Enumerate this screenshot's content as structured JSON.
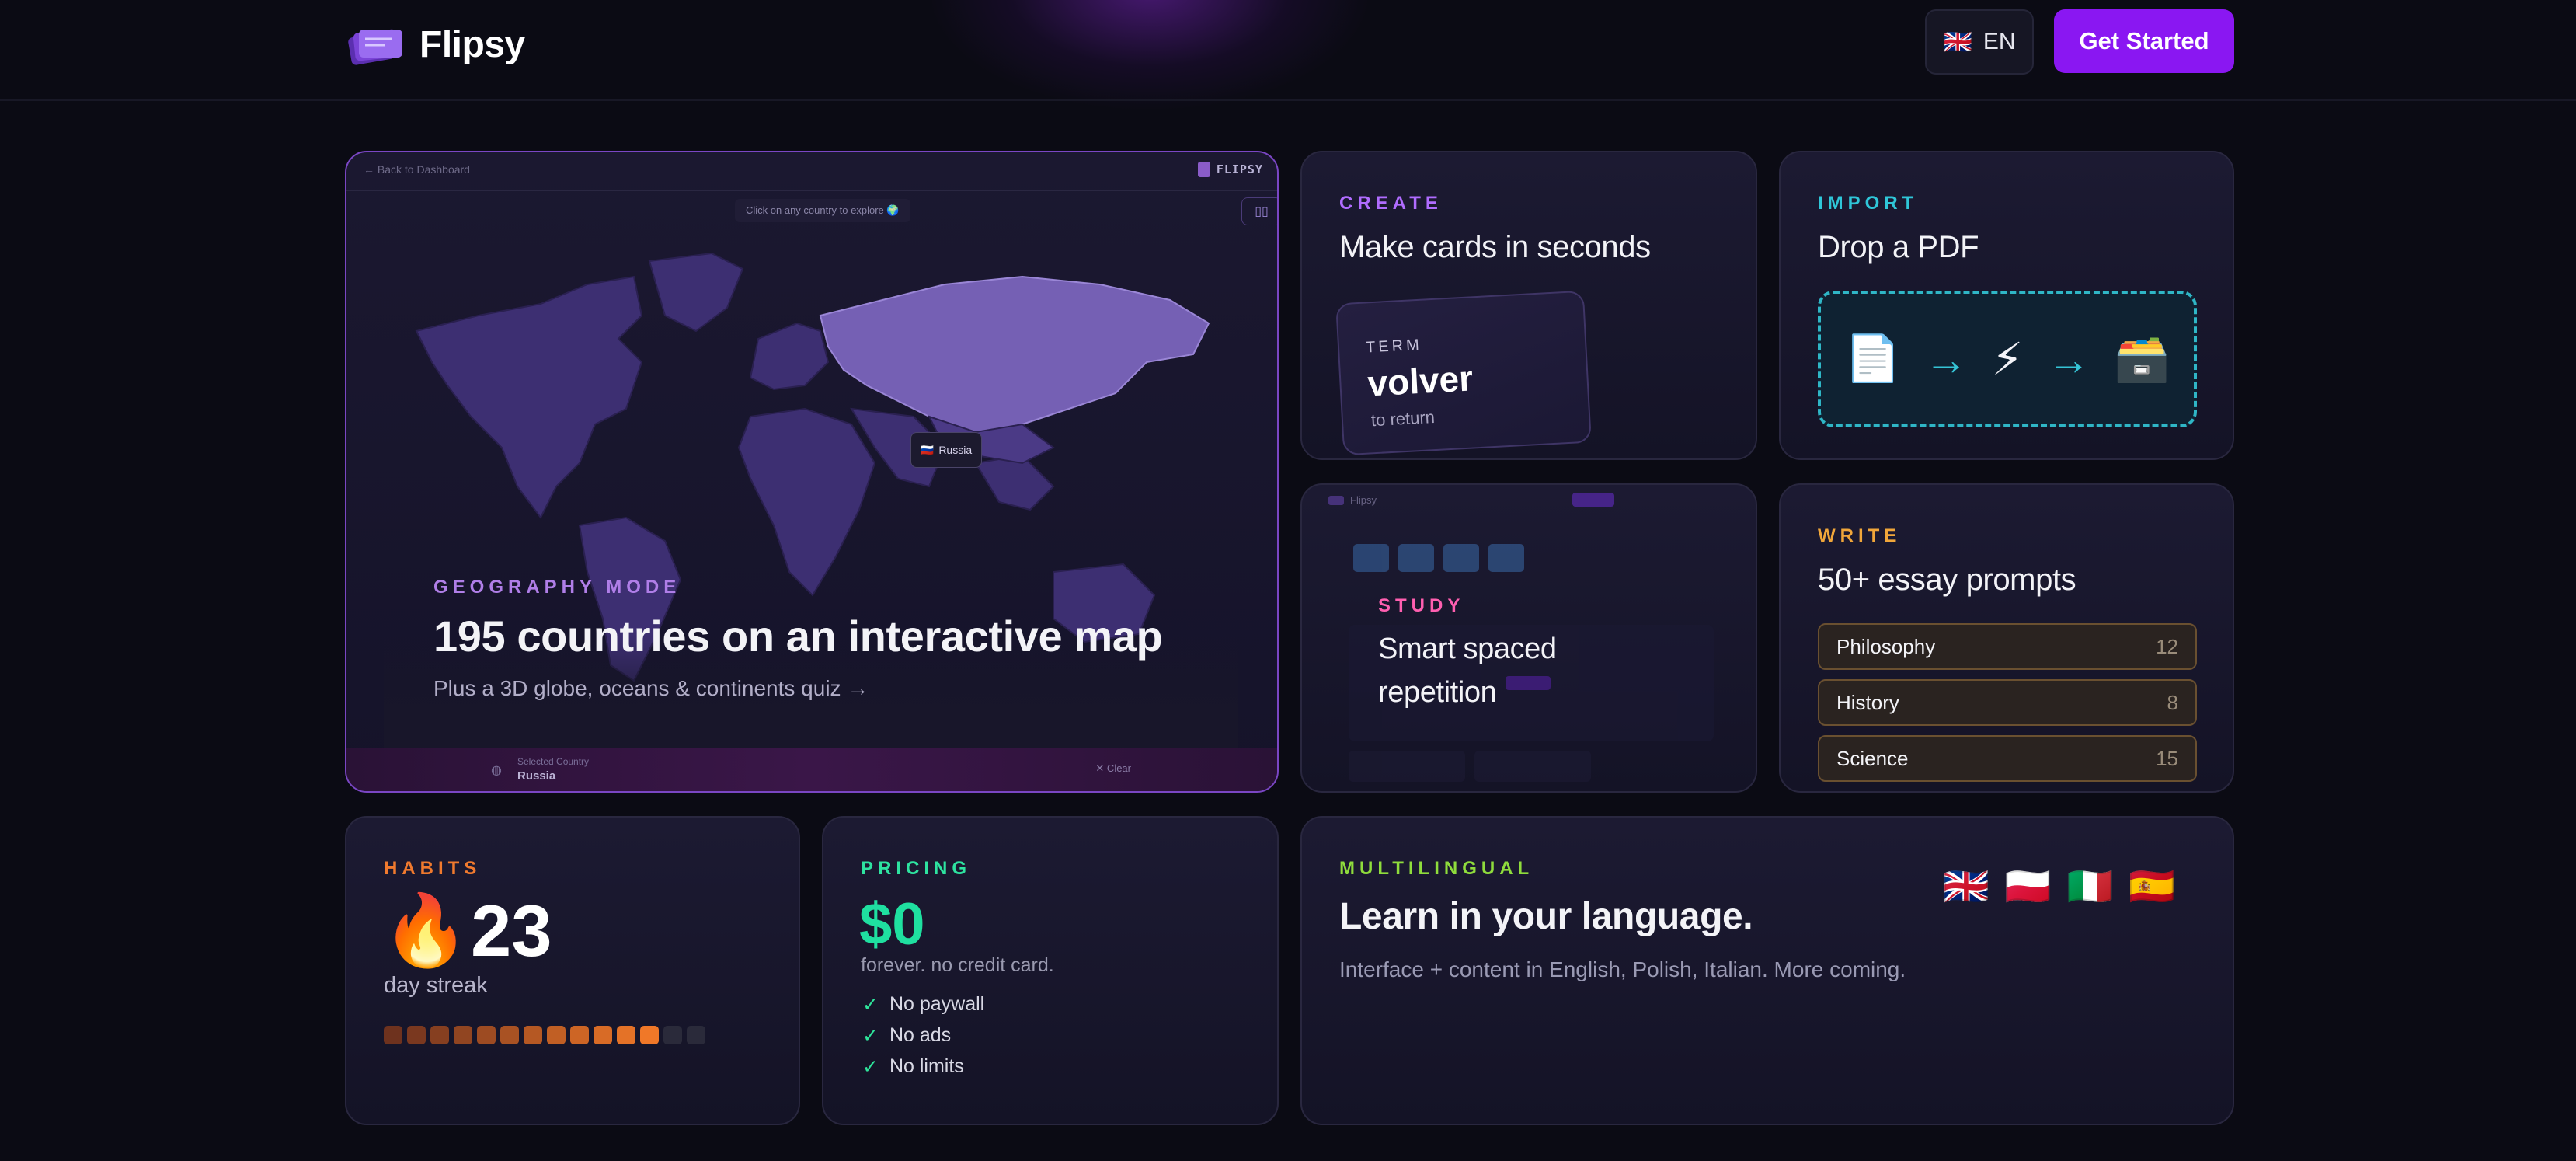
{
  "header": {
    "brand": "Flipsy",
    "lang_flag": "🇬🇧",
    "lang_label": "EN",
    "cta": "Get Started"
  },
  "geo": {
    "back": "Back to Dashboard",
    "brand": "FLIPSY",
    "hint": "Click on any country to explore 🌍",
    "tooltip_flag": "🇷🇺",
    "tooltip": "Russia",
    "eyebrow": "GEOGRAPHY MODE",
    "title": "195 countries on an interactive map",
    "subtitle": "Plus a 3D globe, oceans & continents quiz →",
    "selected_label": "Selected Country",
    "selected_value": "Russia",
    "clear": "✕ Clear"
  },
  "create": {
    "eyebrow": "CREATE",
    "title": "Make cards in seconds",
    "term_label": "TERM",
    "term": "volver",
    "translation": "to return"
  },
  "import": {
    "eyebrow": "IMPORT",
    "title": "Drop a PDF",
    "icons": [
      "📄",
      "→",
      "⚡",
      "→",
      "🗃️"
    ]
  },
  "study": {
    "eyebrow": "STUDY",
    "title_line1": "Smart spaced",
    "title_line2": "repetition",
    "shot_brand": "Flipsy"
  },
  "write": {
    "eyebrow": "WRITE",
    "title": "50+ essay prompts",
    "prompts": [
      {
        "name": "Philosophy",
        "count": "12"
      },
      {
        "name": "History",
        "count": "8"
      },
      {
        "name": "Science",
        "count": "15"
      }
    ]
  },
  "habits": {
    "eyebrow": "HABITS",
    "fire": "🔥",
    "streak": "23",
    "label": "day streak",
    "active_days": 12,
    "total_days": 14
  },
  "pricing": {
    "eyebrow": "PRICING",
    "price": "$0",
    "note": "forever. no credit card.",
    "features": [
      "No paywall",
      "No ads",
      "No limits"
    ]
  },
  "multi": {
    "eyebrow": "MULTILINGUAL",
    "title": "Learn in your language.",
    "subtitle": "Interface + content in English, Polish, Italian. More coming.",
    "flags": [
      "🇬🇧",
      "🇵🇱",
      "🇮🇹",
      "🇪🇸"
    ]
  },
  "colors": {
    "accent": "#8a17f2",
    "create": "#b06cff",
    "import": "#2fc6d8",
    "study": "#ff5fb0",
    "write": "#f0a63a",
    "habits": "#f07a2e",
    "pricing": "#2ee3a0",
    "multi": "#8fdc3c"
  }
}
